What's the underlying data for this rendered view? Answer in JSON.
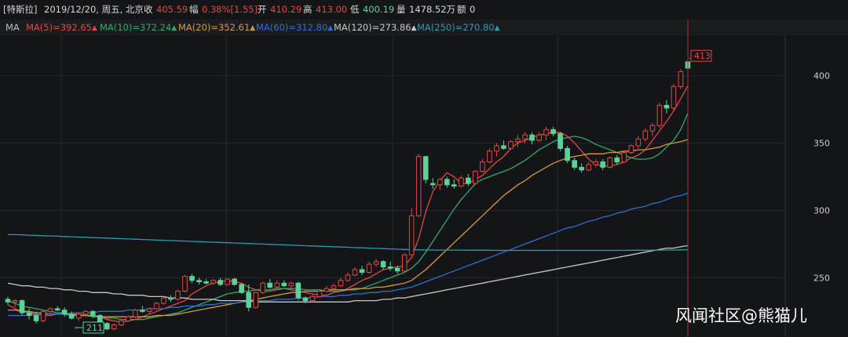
{
  "info_bar": {
    "stock_name": "[特斯拉]",
    "date": "2019/12/20, 周五, 北京",
    "close_label": "收",
    "close_value": "405.59",
    "change_label": "幅",
    "change_value": "0.38%[1.55]",
    "open_label": "开",
    "open_value": "410.29",
    "high_label": "高",
    "high_value": "413.00",
    "low_label": "低",
    "low_value": "400.19",
    "volume_label": "量",
    "volume_value": "1478.52万",
    "amount_label": "额",
    "amount_value": "0"
  },
  "ma_bar": {
    "label": "MA",
    "items": [
      {
        "text": "MA(5)=392.65",
        "color": "#e0493f"
      },
      {
        "text": "MA(10)=372.24",
        "color": "#2eaa6e"
      },
      {
        "text": "MA(20)=352.61",
        "color": "#d49a3e"
      },
      {
        "text": "MA(60)=312.80",
        "color": "#2f6fd1"
      },
      {
        "text": "MA(120)=273.86",
        "color": "#c8c8c8"
      },
      {
        "text": "MA(250)=270.80",
        "color": "#2a9cb0"
      }
    ],
    "arrow": "▲"
  },
  "colors": {
    "up": "#e0493f",
    "down": "#5ad39b",
    "grid": "#26272c",
    "axis_text": "#cfcfcf",
    "info_text": "#d8d8d8",
    "cursor_line": "#b0302b"
  },
  "chart_data": {
    "type": "candlestick",
    "yaxis_ticks": [
      250,
      300,
      350,
      400
    ],
    "ylim": [
      206,
      430
    ],
    "grid": true,
    "annotations": [
      {
        "text": "413",
        "value": 413,
        "color": "#e0493f"
      },
      {
        "text": "211",
        "value": 211,
        "color": "#5ad39b"
      }
    ],
    "candles": [
      [
        234,
        236,
        230,
        232
      ],
      [
        232,
        234,
        228,
        233
      ],
      [
        233,
        234,
        222,
        224
      ],
      [
        224,
        227,
        219,
        222
      ],
      [
        222,
        225,
        216,
        218
      ],
      [
        218,
        226,
        217,
        225
      ],
      [
        225,
        228,
        223,
        227
      ],
      [
        227,
        229,
        225,
        226
      ],
      [
        226,
        228,
        221,
        223
      ],
      [
        223,
        225,
        219,
        220
      ],
      [
        220,
        224,
        218,
        223
      ],
      [
        223,
        226,
        221,
        225
      ],
      [
        225,
        226,
        220,
        222
      ],
      [
        222,
        223,
        215,
        216
      ],
      [
        216,
        217,
        211,
        212
      ],
      [
        212,
        216,
        211,
        215
      ],
      [
        215,
        219,
        214,
        218
      ],
      [
        218,
        222,
        217,
        221
      ],
      [
        221,
        227,
        220,
        226
      ],
      [
        226,
        229,
        224,
        225
      ],
      [
        225,
        228,
        223,
        227
      ],
      [
        227,
        232,
        226,
        231
      ],
      [
        231,
        236,
        230,
        235
      ],
      [
        235,
        237,
        232,
        234
      ],
      [
        234,
        241,
        233,
        240
      ],
      [
        240,
        252,
        239,
        251
      ],
      [
        251,
        253,
        246,
        248
      ],
      [
        248,
        250,
        245,
        247
      ],
      [
        247,
        249,
        245,
        246
      ],
      [
        246,
        249,
        245,
        248
      ],
      [
        248,
        250,
        244,
        245
      ],
      [
        245,
        250,
        244,
        249
      ],
      [
        249,
        250,
        244,
        245
      ],
      [
        245,
        246,
        238,
        239
      ],
      [
        239,
        245,
        225,
        228
      ],
      [
        228,
        240,
        227,
        239
      ],
      [
        239,
        247,
        238,
        246
      ],
      [
        246,
        249,
        242,
        243
      ],
      [
        243,
        248,
        242,
        246
      ],
      [
        246,
        248,
        243,
        244
      ],
      [
        244,
        247,
        241,
        246
      ],
      [
        246,
        247,
        233,
        235
      ],
      [
        235,
        236,
        231,
        233
      ],
      [
        233,
        238,
        232,
        236
      ],
      [
        236,
        241,
        235,
        240
      ],
      [
        240,
        244,
        239,
        242
      ],
      [
        242,
        246,
        241,
        244
      ],
      [
        244,
        250,
        243,
        248
      ],
      [
        248,
        254,
        247,
        252
      ],
      [
        252,
        258,
        251,
        256
      ],
      [
        256,
        259,
        252,
        254
      ],
      [
        254,
        262,
        253,
        260
      ],
      [
        260,
        264,
        258,
        262
      ],
      [
        262,
        263,
        256,
        258
      ],
      [
        258,
        262,
        255,
        257
      ],
      [
        257,
        259,
        253,
        255
      ],
      [
        255,
        268,
        254,
        267
      ],
      [
        267,
        302,
        286,
        296
      ],
      [
        296,
        342,
        295,
        340
      ],
      [
        340,
        336,
        320,
        323
      ],
      [
        320,
        324,
        316,
        319
      ],
      [
        319,
        324,
        315,
        323
      ],
      [
        323,
        325,
        317,
        319
      ],
      [
        319,
        323,
        316,
        318
      ],
      [
        318,
        326,
        317,
        324
      ],
      [
        324,
        327,
        318,
        320
      ],
      [
        320,
        330,
        319,
        329
      ],
      [
        329,
        338,
        328,
        336
      ],
      [
        336,
        346,
        335,
        344
      ],
      [
        344,
        350,
        340,
        348
      ],
      [
        348,
        352,
        345,
        346
      ],
      [
        346,
        352,
        345,
        351
      ],
      [
        351,
        356,
        347,
        353
      ],
      [
        353,
        358,
        350,
        356
      ],
      [
        356,
        358,
        349,
        352
      ],
      [
        352,
        358,
        351,
        356
      ],
      [
        356,
        362,
        352,
        360
      ],
      [
        360,
        362,
        355,
        357
      ],
      [
        357,
        358,
        344,
        346
      ],
      [
        346,
        348,
        335,
        337
      ],
      [
        337,
        339,
        330,
        332
      ],
      [
        332,
        335,
        328,
        330
      ],
      [
        330,
        336,
        329,
        334
      ],
      [
        334,
        338,
        332,
        336
      ],
      [
        336,
        338,
        330,
        332
      ],
      [
        332,
        340,
        331,
        339
      ],
      [
        339,
        341,
        334,
        336
      ],
      [
        336,
        344,
        335,
        343
      ],
      [
        343,
        349,
        342,
        348
      ],
      [
        348,
        355,
        346,
        353
      ],
      [
        353,
        361,
        351,
        359
      ],
      [
        359,
        365,
        355,
        363
      ],
      [
        363,
        380,
        361,
        378
      ],
      [
        378,
        382,
        372,
        376
      ],
      [
        376,
        394,
        374,
        392
      ],
      [
        392,
        405,
        390,
        403
      ],
      [
        410.29,
        413,
        400.19,
        405.59
      ]
    ],
    "ma_series": [
      {
        "name": "MA(5)",
        "color": "#e0493f",
        "values": [
          230,
          227,
          225,
          224,
          223,
          222,
          222,
          223,
          224,
          223,
          223,
          222,
          222,
          221,
          219,
          218,
          217,
          218,
          219,
          221,
          223,
          225,
          227,
          229,
          231,
          233,
          238,
          241,
          244,
          246,
          247,
          248,
          247,
          246,
          243,
          241,
          240,
          240,
          241,
          242,
          241,
          240,
          239,
          238,
          237,
          237,
          239,
          240,
          242,
          245,
          248,
          250,
          253,
          256,
          257,
          258,
          259,
          265,
          279,
          299,
          314,
          322,
          328,
          325,
          320,
          320,
          323,
          326,
          331,
          336,
          340,
          346,
          350,
          352,
          354,
          356,
          357,
          358,
          358,
          355,
          350,
          344,
          338,
          334,
          333,
          333,
          334,
          336,
          339,
          341,
          345,
          352,
          359,
          366,
          374,
          383,
          392.65
        ]
      },
      {
        "name": "MA(10)",
        "color": "#2eaa6e",
        "values": [
          233,
          231,
          229,
          228,
          227,
          226,
          225,
          224,
          224,
          223,
          222,
          222,
          221,
          221,
          220,
          220,
          219,
          219,
          219,
          219,
          220,
          221,
          222,
          223,
          224,
          226,
          228,
          230,
          232,
          234,
          236,
          238,
          239,
          240,
          240,
          241,
          241,
          241,
          242,
          242,
          242,
          242,
          241,
          241,
          241,
          240,
          240,
          240,
          241,
          241,
          242,
          244,
          246,
          248,
          250,
          252,
          254,
          257,
          262,
          269,
          277,
          285,
          293,
          301,
          308,
          314,
          320,
          323,
          325,
          327,
          329,
          331,
          334,
          337,
          341,
          345,
          348,
          351,
          353,
          354,
          355,
          354,
          352,
          349,
          347,
          345,
          343,
          341,
          339,
          338,
          338,
          339,
          342,
          347,
          352,
          360,
          372.24
        ]
      },
      {
        "name": "MA(20)",
        "color": "#d49a3e",
        "values": [
          226,
          226,
          225,
          225,
          224,
          224,
          223,
          223,
          223,
          222,
          222,
          222,
          222,
          221,
          221,
          221,
          221,
          221,
          221,
          221,
          221,
          222,
          222,
          222,
          223,
          224,
          225,
          226,
          227,
          228,
          229,
          230,
          231,
          232,
          233,
          234,
          235,
          236,
          237,
          238,
          239,
          239,
          240,
          240,
          240,
          241,
          241,
          241,
          241,
          242,
          242,
          242,
          243,
          243,
          244,
          245,
          246,
          248,
          252,
          256,
          261,
          266,
          271,
          276,
          281,
          286,
          291,
          296,
          301,
          306,
          311,
          315,
          319,
          322,
          326,
          329,
          332,
          335,
          337,
          339,
          340,
          341,
          342,
          342,
          342,
          343,
          343,
          344,
          344,
          345,
          345,
          346,
          347,
          349,
          350,
          351,
          352.61
        ]
      },
      {
        "name": "MA(60)",
        "color": "#2f6fd1",
        "values": [
          222,
          222,
          222,
          222,
          223,
          223,
          223,
          223,
          223,
          224,
          224,
          224,
          224,
          225,
          225,
          225,
          225,
          226,
          226,
          226,
          227,
          227,
          227,
          228,
          228,
          229,
          229,
          229,
          230,
          230,
          231,
          231,
          231,
          232,
          232,
          233,
          233,
          233,
          234,
          234,
          234,
          235,
          235,
          235,
          236,
          236,
          236,
          237,
          237,
          238,
          238,
          239,
          239,
          240,
          240,
          241,
          242,
          243,
          245,
          247,
          249,
          251,
          253,
          255,
          257,
          259,
          261,
          263,
          265,
          267,
          269,
          271,
          273,
          275,
          277,
          279,
          281,
          283,
          285,
          287,
          288,
          290,
          292,
          293,
          295,
          296,
          298,
          299,
          301,
          302,
          303,
          305,
          306,
          308,
          310,
          311,
          312.8
        ]
      },
      {
        "name": "MA(120)",
        "color": "#c8c8c8",
        "values": [
          246,
          245,
          244,
          244,
          243,
          243,
          242,
          242,
          241,
          241,
          240,
          240,
          239,
          239,
          239,
          238,
          238,
          237,
          237,
          237,
          236,
          236,
          236,
          235,
          235,
          235,
          234,
          234,
          234,
          234,
          233,
          233,
          233,
          233,
          233,
          232,
          232,
          232,
          232,
          232,
          232,
          232,
          232,
          232,
          232,
          232,
          232,
          232,
          232,
          233,
          233,
          233,
          233,
          234,
          234,
          235,
          235,
          236,
          237,
          238,
          239,
          240,
          241,
          242,
          243,
          244,
          245,
          246,
          247,
          248,
          249,
          250,
          251,
          252,
          253,
          254,
          255,
          256,
          257,
          258,
          259,
          260,
          261,
          262,
          263,
          264,
          265,
          266,
          267,
          268,
          269,
          270,
          271,
          272,
          272,
          273,
          273.86
        ]
      },
      {
        "name": "MA(250)",
        "color": "#2a9cb0",
        "values": [
          282,
          282,
          281.8,
          281.6,
          281.4,
          281.2,
          281,
          280.8,
          280.6,
          280.4,
          280.2,
          280,
          279.8,
          279.6,
          279.4,
          279.2,
          279,
          278.8,
          278.6,
          278.4,
          278.2,
          278,
          277.8,
          277.6,
          277.4,
          277.2,
          277,
          276.8,
          276.6,
          276.4,
          276.2,
          276,
          275.8,
          275.6,
          275.4,
          275.2,
          275,
          274.8,
          274.6,
          274.4,
          274.2,
          274,
          273.8,
          273.6,
          273.4,
          273.2,
          273,
          272.8,
          272.6,
          272.4,
          272.2,
          272,
          271.8,
          271.6,
          271.4,
          271.2,
          271,
          270.8,
          270.7,
          270.6,
          270.6,
          270.5,
          270.5,
          270.5,
          270.5,
          270.4,
          270.4,
          270.4,
          270.4,
          270.3,
          270.3,
          270.3,
          270.3,
          270.3,
          270.3,
          270.3,
          270.3,
          270.3,
          270.3,
          270.3,
          270.3,
          270.3,
          270.3,
          270.3,
          270.3,
          270.3,
          270.3,
          270.3,
          270.4,
          270.4,
          270.4,
          270.5,
          270.5,
          270.6,
          270.6,
          270.7,
          270.8
        ]
      }
    ]
  },
  "watermark": "风闻社区@熊猫儿"
}
